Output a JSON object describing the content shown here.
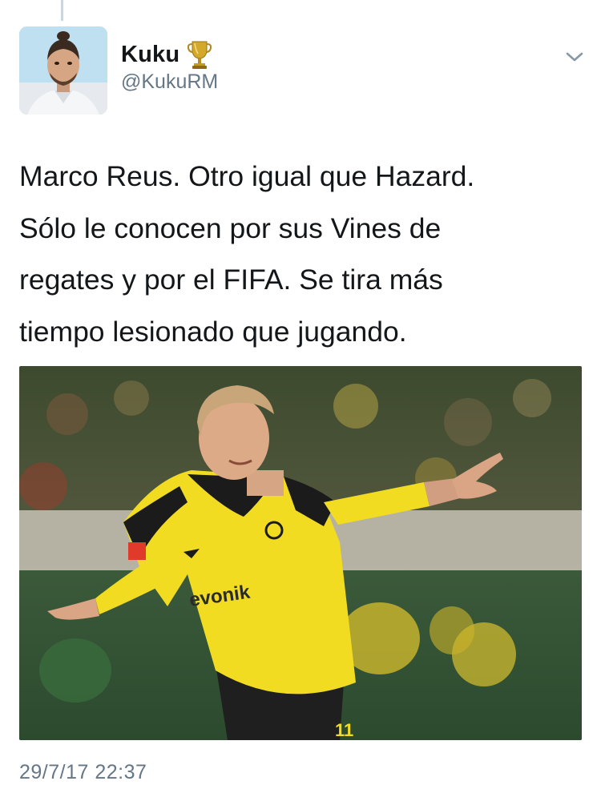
{
  "tweet": {
    "author": {
      "display_name": "Kuku",
      "badge_icon": "trophy-icon",
      "handle": "@KukuRM"
    },
    "menu_icon": "chevron-down-icon",
    "text": "Marco Reus. Otro igual que Hazard.\nSólo le conocen por sus Vines de\nregates y por el FIFA. Se tira más\ntiempo lesionado que jugando.",
    "media": {
      "jersey_sponsor": "evonik",
      "jersey_number": "11"
    },
    "timestamp": "29/7/17 22:37"
  },
  "colors": {
    "text_primary": "#14171a",
    "text_secondary": "#657786",
    "jersey_yellow": "#f4e12a",
    "trophy_gold": "#d4a82a"
  }
}
